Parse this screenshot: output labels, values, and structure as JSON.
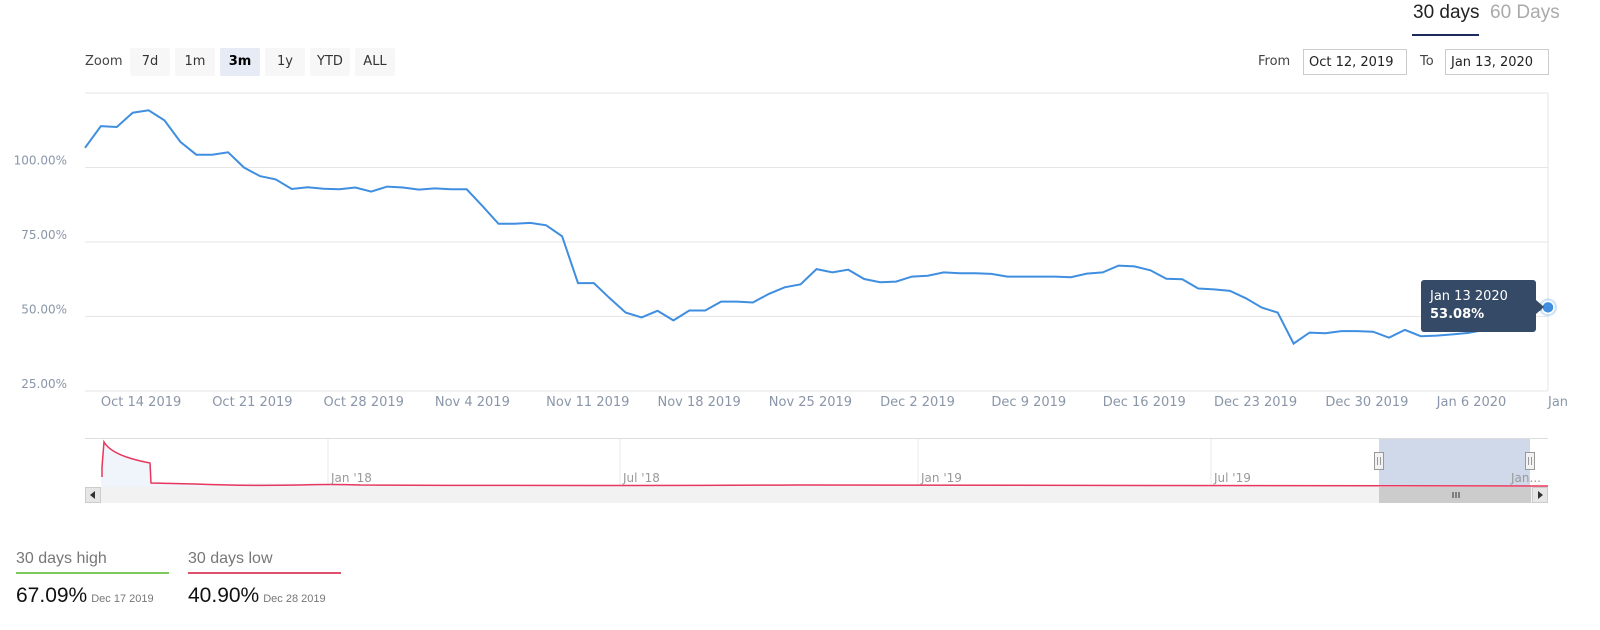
{
  "tabs": [
    {
      "label": "30 days",
      "active": true
    },
    {
      "label": "60 Days",
      "active": false
    }
  ],
  "range_selector": {
    "zoom_label": "Zoom",
    "buttons": [
      {
        "label": "7d"
      },
      {
        "label": "1m"
      },
      {
        "label": "3m",
        "selected": true
      },
      {
        "label": "1y"
      },
      {
        "label": "YTD"
      },
      {
        "label": "ALL"
      }
    ],
    "from_label": "From",
    "from_value": "Oct 12, 2019",
    "to_label": "To",
    "to_value": "Jan 13, 2020"
  },
  "tooltip": {
    "date": "Jan 13 2020",
    "value": "53.08%"
  },
  "navigator": {
    "labels": [
      "Jan '18",
      "Jul '18",
      "Jan '19",
      "Jul '19",
      "Jan..."
    ]
  },
  "stats": {
    "high": {
      "label": "30 days high",
      "value": "67.09%",
      "date": "Dec 17 2019",
      "color": "#7dc95e"
    },
    "low": {
      "label": "30 days low",
      "value": "40.90%",
      "date": "Dec 28 2019",
      "color": "#e0506d"
    }
  },
  "colors": {
    "line": "#3f8ee0",
    "navigator": "#e8365d",
    "tooltip_bg": "#354a66",
    "selected_range": "#d0d9ea"
  },
  "chart_data": {
    "type": "line",
    "title": "",
    "xlabel": "",
    "ylabel": "",
    "ylim": [
      25,
      125
    ],
    "xlim": [
      "2019-10-12",
      "2020-01-13"
    ],
    "grid": true,
    "y_ticks": [
      {
        "value": 100,
        "label": "100.00%"
      },
      {
        "value": 75,
        "label": "75.00%"
      },
      {
        "value": 50,
        "label": "50.00%"
      },
      {
        "value": 25,
        "label": "25.00%"
      }
    ],
    "x_ticks": [
      {
        "date": "2019-10-14",
        "label": "Oct 14 2019"
      },
      {
        "date": "2019-10-21",
        "label": "Oct 21 2019"
      },
      {
        "date": "2019-10-28",
        "label": "Oct 28 2019"
      },
      {
        "date": "2019-11-04",
        "label": "Nov 4 2019"
      },
      {
        "date": "2019-11-11",
        "label": "Nov 11 2019"
      },
      {
        "date": "2019-11-18",
        "label": "Nov 18 2019"
      },
      {
        "date": "2019-11-25",
        "label": "Nov 25 2019"
      },
      {
        "date": "2019-12-02",
        "label": "Dec 2 2019"
      },
      {
        "date": "2019-12-09",
        "label": "Dec 9 2019"
      },
      {
        "date": "2019-12-16",
        "label": "Dec 16 2019"
      },
      {
        "date": "2019-12-23",
        "label": "Dec 23 2019"
      },
      {
        "date": "2019-12-30",
        "label": "Dec 30 2019"
      },
      {
        "date": "2020-01-06",
        "label": "Jan 6 2020"
      },
      {
        "date": "2020-01-13",
        "label": "Jan"
      }
    ],
    "x_start": "2019-10-13",
    "x_step": "1 day",
    "values": [
      106.6,
      113.9,
      113.6,
      118.4,
      119.2,
      115.8,
      108.6,
      104.3,
      104.3,
      105.1,
      100.0,
      97.1,
      96.0,
      92.8,
      93.4,
      92.9,
      92.7,
      93.3,
      91.9,
      93.6,
      93.3,
      92.6,
      93.0,
      92.7,
      92.7,
      87.0,
      81.1,
      81.1,
      81.4,
      80.6,
      76.9,
      61.2,
      61.2,
      56.1,
      51.3,
      49.7,
      51.9,
      48.7,
      52.0,
      52.0,
      55.0,
      55.0,
      54.7,
      57.6,
      59.8,
      60.8,
      65.9,
      64.8,
      65.7,
      62.6,
      61.5,
      61.7,
      63.4,
      63.7,
      64.8,
      64.5,
      64.5,
      64.3,
      63.4,
      63.4,
      63.4,
      63.4,
      63.2,
      64.4,
      64.8,
      67.09,
      66.8,
      65.5,
      62.7,
      62.5,
      59.4,
      59.1,
      58.6,
      56.1,
      53.0,
      51.3,
      40.9,
      44.6,
      44.4,
      45.1,
      45.1,
      44.9,
      42.9,
      45.5,
      43.4,
      43.6,
      44.0,
      44.5,
      45.5,
      47.0,
      49.5,
      51.5,
      53.08
    ]
  }
}
